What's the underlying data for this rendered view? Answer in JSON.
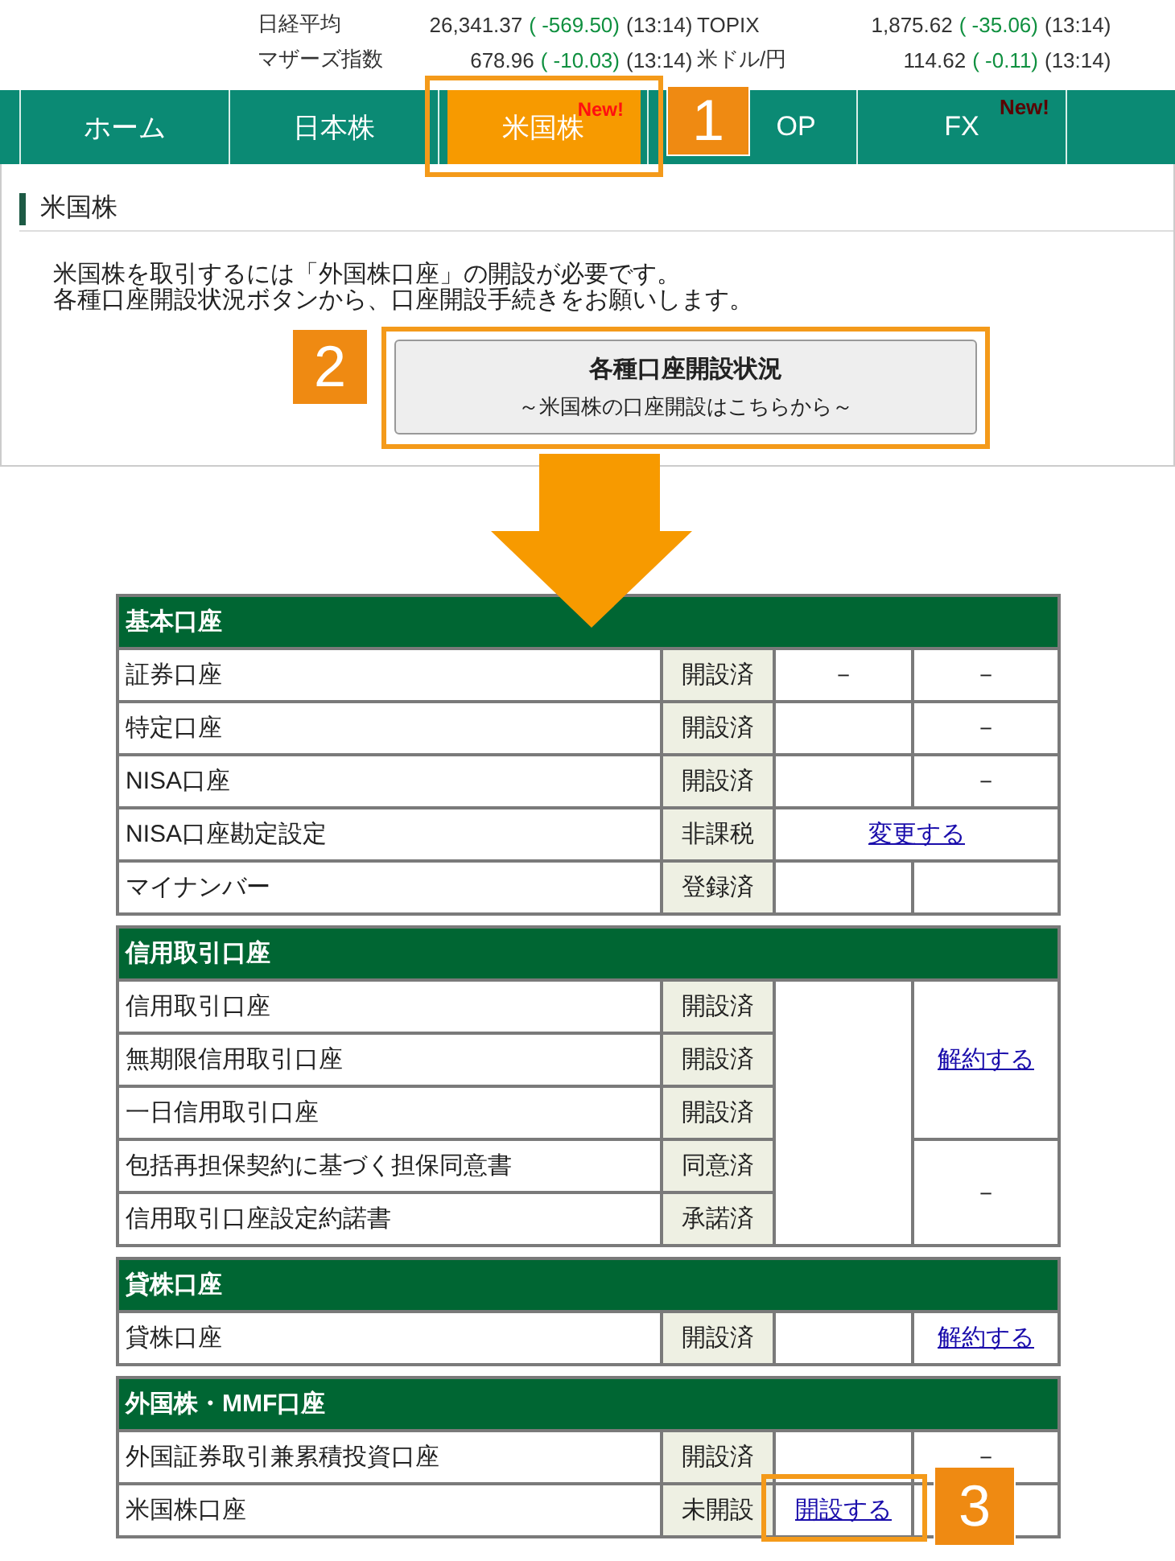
{
  "ticker": [
    {
      "name": "日経平均",
      "value": "26,341.37",
      "change": "( -569.50)",
      "time": "(13:14)"
    },
    {
      "name": "TOPIX",
      "value": "1,875.62",
      "change": "( -35.06)",
      "time": "(13:14)"
    },
    {
      "name": "マザーズ指数",
      "value": "678.96",
      "change": "( -10.03)",
      "time": "(13:14)"
    },
    {
      "name": "米ドル/円",
      "value": "114.62",
      "change": "( -0.11)",
      "time": "(13:14)"
    }
  ],
  "nav": {
    "tabs": [
      {
        "label": "ホーム",
        "selected": false
      },
      {
        "label": "日本株",
        "selected": false
      },
      {
        "label": "米国株",
        "selected": true,
        "badge": "New!",
        "highlighted": true,
        "callout": "1"
      },
      {
        "label": "OP",
        "selected": false
      },
      {
        "label": "FX",
        "selected": false,
        "badge": "New!"
      }
    ]
  },
  "intro": {
    "heading": "米国株",
    "lines": [
      "米国株を取引するには「外国株口座」の開設が必要です。",
      "各種口座開設状況ボタンから、口座開設手続きをお願いします。"
    ],
    "button": {
      "title": "各種口座開設状況",
      "subtitle": "～米国株の口座開設はこちらから～",
      "highlighted": true,
      "callout": "2"
    }
  },
  "sections": [
    {
      "title": "基本口座",
      "rows": [
        {
          "name": "証券口座",
          "status": "開設済",
          "cells": [
            {
              "kind": "text",
              "text": "－"
            },
            {
              "kind": "text",
              "text": "－"
            }
          ]
        },
        {
          "name": "特定口座",
          "status": "開設済",
          "cells": [
            {
              "kind": "empty"
            },
            {
              "kind": "text",
              "text": "－"
            }
          ]
        },
        {
          "name": "NISA口座",
          "status": "開設済",
          "cells": [
            {
              "kind": "empty"
            },
            {
              "kind": "text",
              "text": "－"
            }
          ]
        },
        {
          "name": "NISA口座勘定設定",
          "status": "非課税",
          "cells": [
            {
              "kind": "link",
              "text": "変更する",
              "colspan": 2
            }
          ]
        },
        {
          "name": "マイナンバー",
          "status": "登録済",
          "cells": [
            {
              "kind": "empty"
            },
            {
              "kind": "empty"
            }
          ]
        }
      ]
    },
    {
      "title": "信用取引口座",
      "rows": [
        {
          "name": "信用取引口座",
          "status": "開設済",
          "cells": [
            {
              "kind": "empty",
              "rowspan": 5
            },
            {
              "kind": "link",
              "text": "解約する",
              "rowspan": 3
            }
          ]
        },
        {
          "name": "無期限信用取引口座",
          "status": "開設済"
        },
        {
          "name": "一日信用取引口座",
          "status": "開設済"
        },
        {
          "name": "包括再担保契約に基づく担保同意書",
          "status": "同意済",
          "cells": [
            {
              "kind": "text",
              "text": "－",
              "rowspan": 2
            }
          ]
        },
        {
          "name": "信用取引口座設定約諾書",
          "status": "承諾済"
        }
      ]
    },
    {
      "title": "貸株口座",
      "rows": [
        {
          "name": "貸株口座",
          "status": "開設済",
          "cells": [
            {
              "kind": "empty"
            },
            {
              "kind": "link",
              "text": "解約する"
            }
          ]
        }
      ]
    },
    {
      "title": "外国株・MMF口座",
      "rows": [
        {
          "name": "外国証券取引兼累積投資口座",
          "status": "開設済",
          "cells": [
            {
              "kind": "empty"
            },
            {
              "kind": "text",
              "text": "－"
            }
          ]
        },
        {
          "name": "米国株口座",
          "status": "未開設",
          "cells": [
            {
              "kind": "link",
              "text": "開設する",
              "highlighted": true,
              "callout": "3"
            },
            {
              "kind": "empty"
            }
          ]
        }
      ]
    }
  ]
}
